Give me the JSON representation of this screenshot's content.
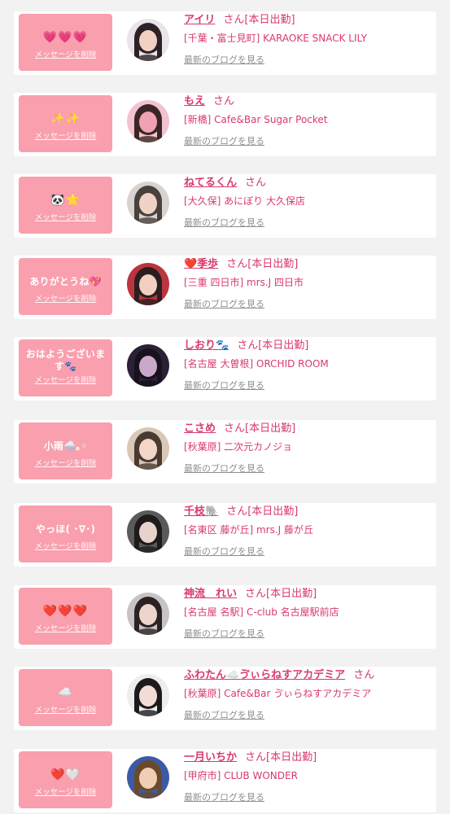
{
  "honorific": "さん",
  "delete_label": "メッセージを削除",
  "blog_label": "最新のブログを見る",
  "colors": {
    "card_bg": "#ffffff",
    "page_bg": "#f2f2f2",
    "message_bg": "#f99fad",
    "accent_text": "#d93a6b",
    "muted_text": "#8f8f8f"
  },
  "entries": [
    {
      "message": "💗💗💗",
      "name": "アイリ",
      "status": "[本日出勤]",
      "shop": "[千葉・富士見町] KARAOKE SNACK LILY",
      "avatar_palette": [
        "#e9e4ea",
        "#2b2127",
        "#f2d1c3"
      ]
    },
    {
      "message": "✨✨",
      "name": "もえ",
      "status": "",
      "shop": "[新橋] Cafe&Bar Sugar Pocket",
      "avatar_palette": [
        "#f3c2d2",
        "#3a2622",
        "#f0a2b4"
      ]
    },
    {
      "message": "🐼🌟",
      "name": "ねてるくん",
      "status": "",
      "shop": "[大久保] あにぼり 大久保店",
      "avatar_palette": [
        "#d7d3d0",
        "#4a403c",
        "#efd3c6"
      ]
    },
    {
      "message": "ありがとうね💖",
      "name": "❤️季歩",
      "status": "[本日出勤]",
      "shop": "[三重 四日市] mrs.J 四日市",
      "avatar_palette": [
        "#b9353f",
        "#2b1e1f",
        "#f2cfc1"
      ]
    },
    {
      "message": "おはようございます🐾",
      "name": "しおり🐾",
      "status": "[本日出勤]",
      "shop": "[名古屋 大曽根] ORCHID ROOM",
      "avatar_palette": [
        "#2a2138",
        "#17121c",
        "#c9a9c9"
      ]
    },
    {
      "message": "小雨🌧️｡◦",
      "name": "こさめ",
      "status": "[本日出勤]",
      "shop": "[秋葉原] 二次元カノジョ",
      "avatar_palette": [
        "#d8c8b8",
        "#4a3a32",
        "#f3d6c8"
      ]
    },
    {
      "message": "やっほ( ･∇･)",
      "name": "千枝🐘",
      "status": "[本日出勤]",
      "shop": "[名東区 藤が丘] mrs.J 藤が丘",
      "avatar_palette": [
        "#5a5a5a",
        "#1f1b1b",
        "#e8d3cc"
      ]
    },
    {
      "message": "❤️❤️❤️",
      "name": "神流　れい",
      "status": "[本日出勤]",
      "shop": "[名古屋 名駅] C-club 名古屋駅前店",
      "avatar_palette": [
        "#c7c2c4",
        "#2a2223",
        "#eed5cc"
      ]
    },
    {
      "message": "☁️",
      "name": "ふわたん☁️ゔぃらねすアカデミア",
      "status": "",
      "shop": "[秋葉原] Cafe&Bar ゔぃらねすアカデミア",
      "avatar_palette": [
        "#ededed",
        "#1b1a1d",
        "#f4dcd6"
      ]
    },
    {
      "message": "❤️🤍",
      "name": "一月いちか",
      "status": "[本日出勤]",
      "shop": "[甲府市] CLUB WONDER",
      "avatar_palette": [
        "#3c5aa8",
        "#6b4a2a",
        "#f1cdb5"
      ]
    }
  ]
}
